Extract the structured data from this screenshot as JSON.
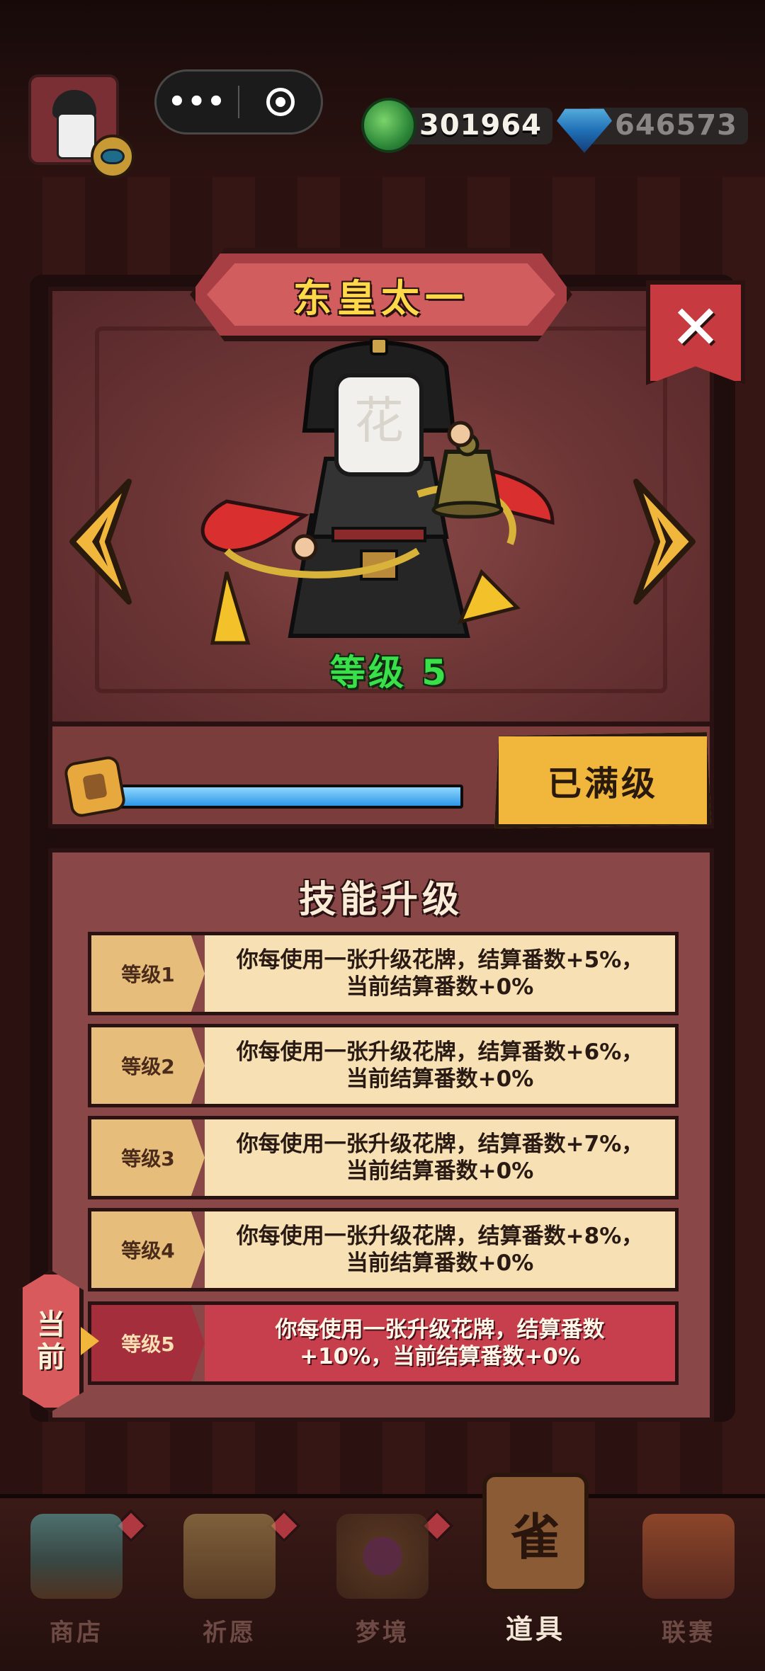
{
  "topbar": {
    "more_label": "•••",
    "jade_value": "301964",
    "gem_value": "646573"
  },
  "character": {
    "name": "东皇太一",
    "level_label": "等级 5",
    "close_label": "✕",
    "xp_progress": 1.0,
    "maxed_label": "已满级"
  },
  "skills": {
    "title": "技能升级",
    "current_badge": "当\n前",
    "rows": [
      {
        "tag": "等级1",
        "text": "你每使用一张升级花牌，结算番数+5%，\n当前结算番数+0%"
      },
      {
        "tag": "等级2",
        "text": "你每使用一张升级花牌，结算番数+6%，\n当前结算番数+0%"
      },
      {
        "tag": "等级3",
        "text": "你每使用一张升级花牌，结算番数+7%，\n当前结算番数+0%"
      },
      {
        "tag": "等级4",
        "text": "你每使用一张升级花牌，结算番数+8%，\n当前结算番数+0%"
      },
      {
        "tag": "等级5",
        "text": "你每使用一张升级花牌，结算番数\n+10%，当前结算番数+0%"
      }
    ]
  },
  "nav": {
    "items": [
      {
        "label": "商店"
      },
      {
        "label": "祈愿"
      },
      {
        "label": "梦境"
      },
      {
        "label": "道具"
      },
      {
        "label": "联赛"
      }
    ],
    "item_glyph": "雀"
  },
  "colors": {
    "accent_gold": "#f1b73c",
    "level_green": "#39e04a",
    "current_row": "#c73e4d"
  }
}
